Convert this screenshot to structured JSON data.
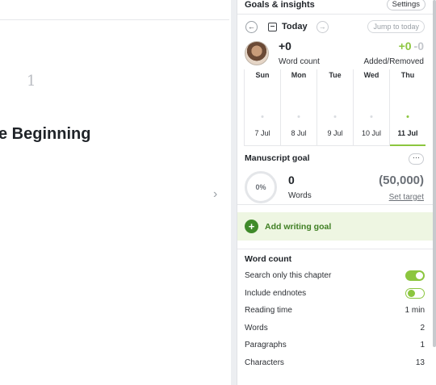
{
  "editor": {
    "chapter_number": "1",
    "chapter_title": "e Beginning",
    "collapse_icon": "chevron-right-icon"
  },
  "panel": {
    "title": "Goals & insights",
    "settings_label": "Settings",
    "today_label": "Today",
    "jump_label": "Jump to today",
    "word_count": {
      "value": "+0",
      "label": "Word count",
      "added": "+0",
      "removed": "-0",
      "added_removed_label": "Added/Removed"
    },
    "week": [
      {
        "name": "Sun",
        "date": "7 Jul",
        "active": false
      },
      {
        "name": "Mon",
        "date": "8 Jul",
        "active": false
      },
      {
        "name": "Tue",
        "date": "9 Jul",
        "active": false
      },
      {
        "name": "Wed",
        "date": "10 Jul",
        "active": false
      },
      {
        "name": "Thu",
        "date": "11 Jul",
        "active": true
      }
    ],
    "manuscript_goal": {
      "title": "Manuscript goal",
      "more_label": "···",
      "percent": "0%",
      "value": "0",
      "unit": "Words",
      "target": "(50,000)",
      "set_target_label": "Set target"
    },
    "add_goal_label": "Add writing goal",
    "word_count_section": {
      "title": "Word count",
      "rows": [
        {
          "label": "Search only this chapter",
          "type": "toggle",
          "on": true
        },
        {
          "label": "Include endnotes",
          "type": "toggle",
          "on": false
        },
        {
          "label": "Reading time",
          "value": "1 min"
        },
        {
          "label": "Words",
          "value": "2"
        },
        {
          "label": "Paragraphs",
          "value": "1"
        },
        {
          "label": "Characters",
          "value": "13"
        }
      ]
    }
  },
  "colors": {
    "accent": "#8cc63f",
    "accent_dark": "#3f8a2a",
    "goal_bg": "#eef6e2"
  }
}
